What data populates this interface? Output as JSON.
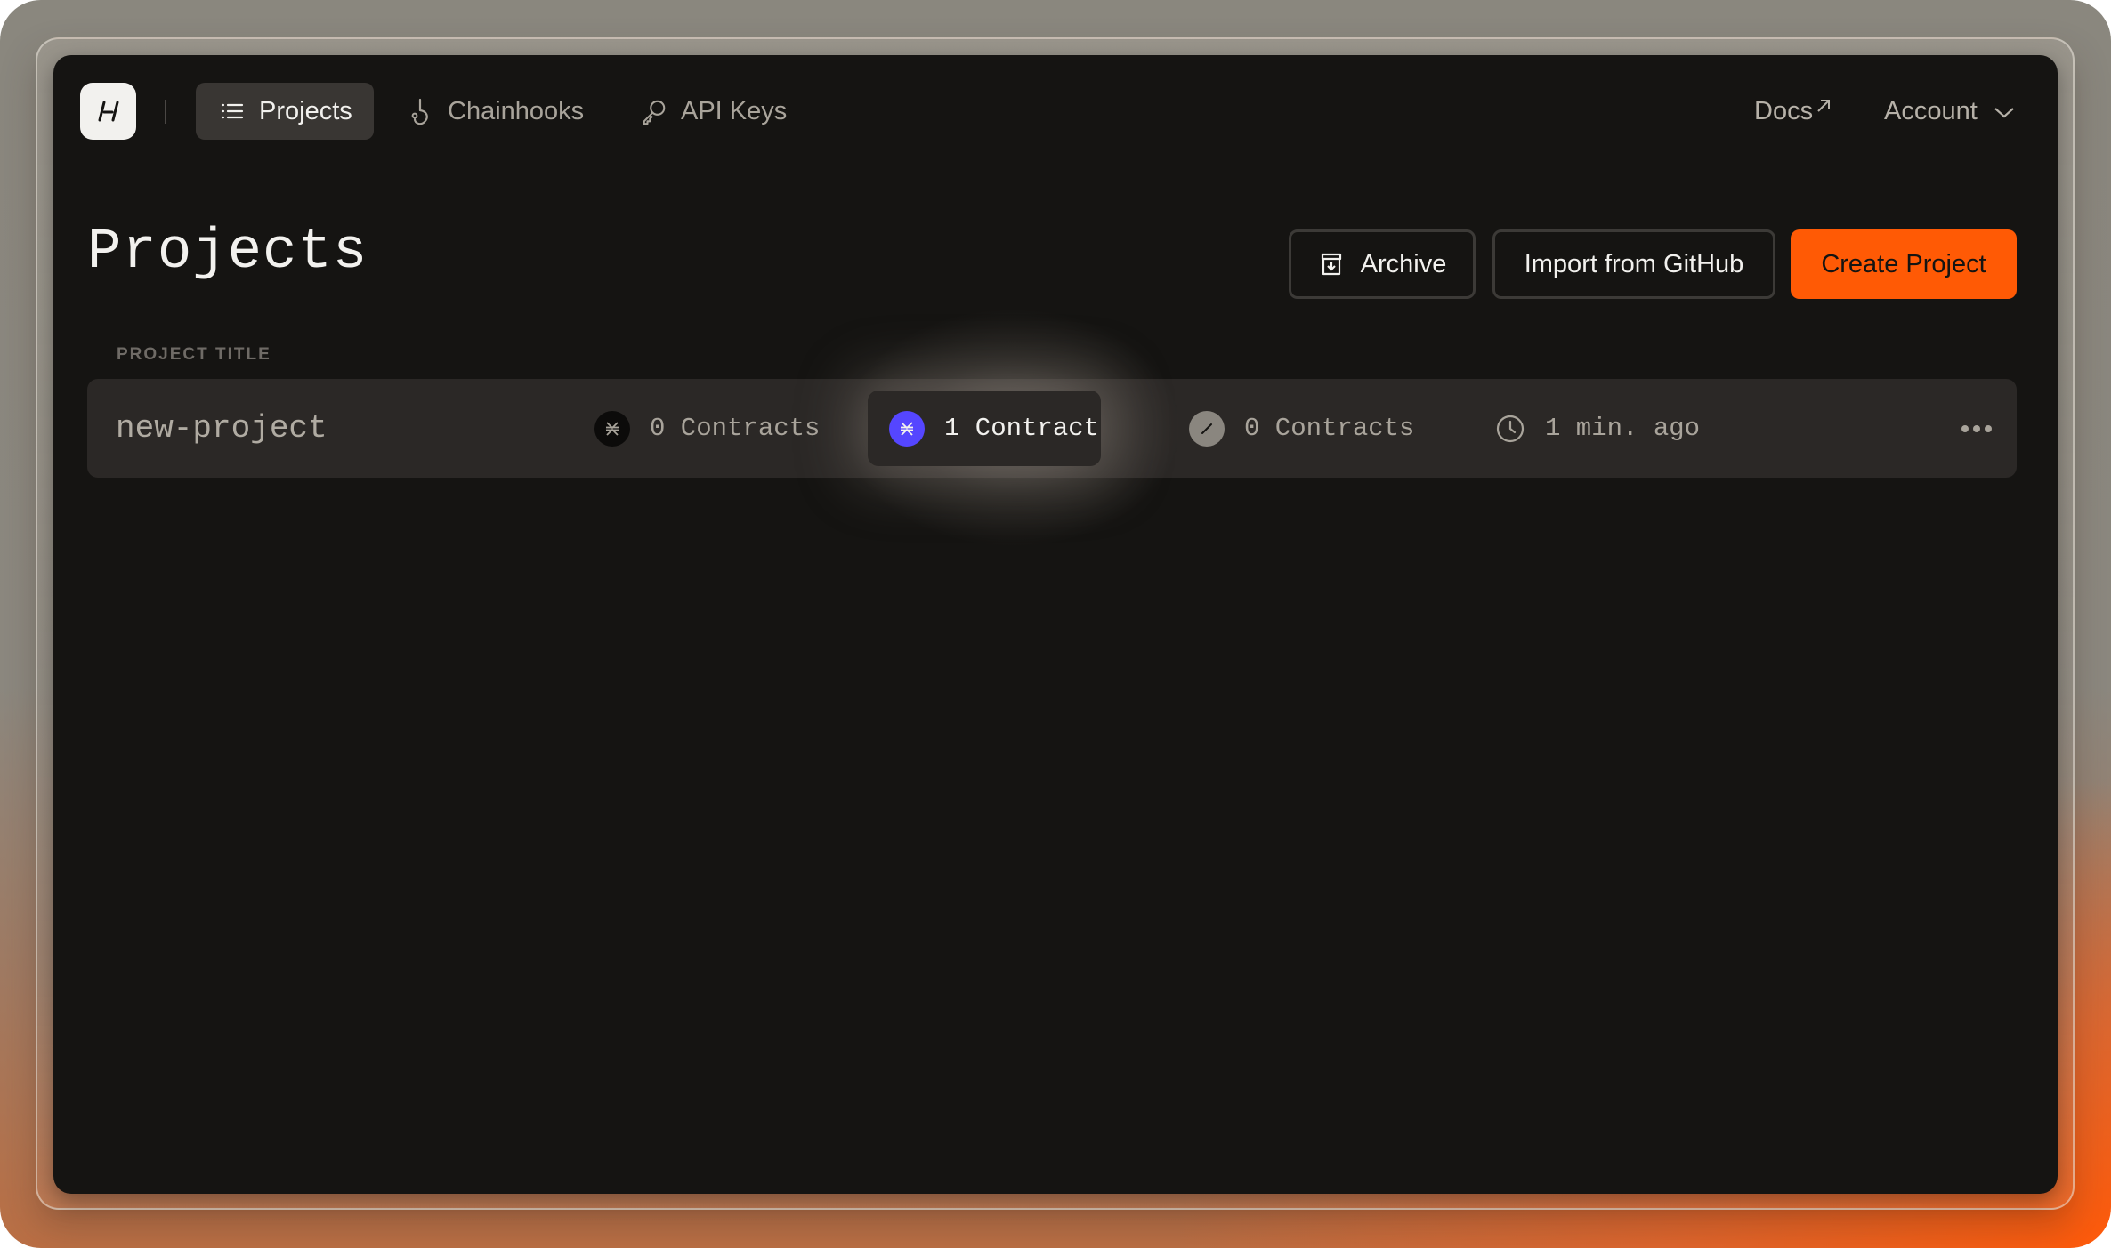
{
  "logo": {
    "text": "/-/"
  },
  "nav": {
    "tabs": [
      {
        "label": "Projects",
        "icon": "list-icon",
        "active": true
      },
      {
        "label": "Chainhooks",
        "icon": "hook-icon",
        "active": false
      },
      {
        "label": "API Keys",
        "icon": "key-icon",
        "active": false
      }
    ],
    "docs_label": "Docs",
    "docs_icon": "external-link-icon",
    "account_label": "Account",
    "account_icon": "chevron-down-icon"
  },
  "page": {
    "title": "Projects",
    "archive_label": "Archive",
    "import_label": "Import from GitHub",
    "create_label": "Create Project"
  },
  "table": {
    "column_label": "PROJECT TITLE",
    "rows": [
      {
        "title": "new-project",
        "stacks_mainnet": {
          "icon": "stacks-icon",
          "label": "0 Contracts"
        },
        "stacks_devnet": {
          "icon": "stacks-icon",
          "label": "1 Contract",
          "highlighted": true
        },
        "other_network": {
          "icon": "slash-icon",
          "label": "0 Contracts"
        },
        "updated": {
          "icon": "clock-icon",
          "label": "1 min. ago"
        },
        "menu_icon": "more-horizontal-icon"
      }
    ]
  },
  "colors": {
    "accent": "#ff5a05",
    "stacks_purple": "#5546ff",
    "panel_bg": "#151412",
    "row_bg": "#2b2826"
  }
}
